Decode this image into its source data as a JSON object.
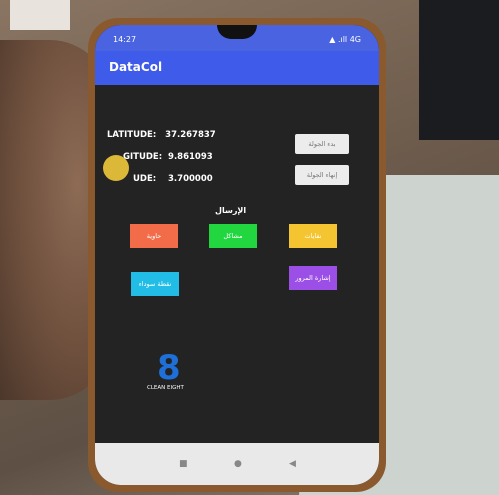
{
  "status_bar": {
    "time": "14:27",
    "signal": "▲ .ıll 4G"
  },
  "app": {
    "title": "DataCol"
  },
  "coords": {
    "latitude_label": "LATITUDE:",
    "latitude_value": "37.267837",
    "longitude_label": "GITUDE:",
    "longitude_value": "9.861093",
    "altitude_label": "UDE:",
    "altitude_value": "3.700000"
  },
  "buttons": {
    "start_tour": "بدء الجولة",
    "end_tour": "إنهاء الجولة",
    "send_label": "الإرسال",
    "container": "حاوية",
    "problem": "مشاكل",
    "waste": "نفايات",
    "black_spot": "نقطة سوداء",
    "traffic_signal": "إشارة المرور"
  },
  "logo": {
    "text": "CLEAN EIGHT"
  },
  "colors": {
    "appbar": "#3e5bea",
    "container": "#f36c4a",
    "problem": "#22d640",
    "waste": "#f5c531",
    "black_spot": "#22bde6",
    "traffic_signal": "#9b4fe6"
  },
  "nav": {
    "square": "■",
    "home": "●",
    "back": "◀"
  }
}
